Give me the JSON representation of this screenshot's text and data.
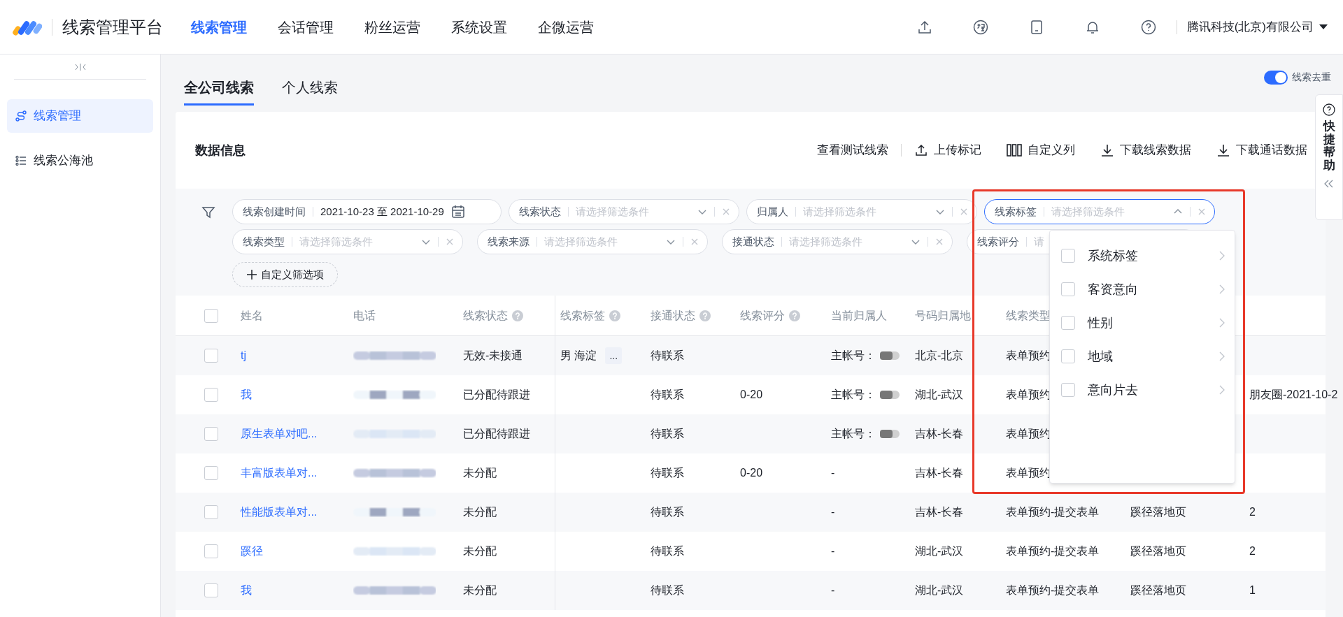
{
  "app": {
    "title": "线索管理平台"
  },
  "nav": [
    {
      "label": "线索管理",
      "selected": true
    },
    {
      "label": "会话管理",
      "selected": false
    },
    {
      "label": "粉丝运营",
      "selected": false
    },
    {
      "label": "系统设置",
      "selected": false
    },
    {
      "label": "企微运营",
      "selected": false
    }
  ],
  "account": {
    "company": "腾讯科技(北京)有限公司"
  },
  "sidebar": {
    "items": [
      {
        "label": "线索管理",
        "selected": true,
        "kind": "route"
      },
      {
        "label": "线索公海池",
        "selected": false,
        "kind": "pool"
      }
    ]
  },
  "tabs": [
    {
      "label": "全公司线索",
      "selected": true
    },
    {
      "label": "个人线索",
      "selected": false
    }
  ],
  "dedupe_toggle": {
    "label": "线索去重",
    "on": true
  },
  "section_title": "数据信息",
  "actions": [
    {
      "label": "查看测试线索",
      "kind": "text"
    },
    {
      "label": "上传标记",
      "kind": "upload"
    },
    {
      "label": "自定义列",
      "kind": "columns"
    },
    {
      "label": "下载线索数据",
      "kind": "download"
    },
    {
      "label": "下载通话数据",
      "kind": "download"
    }
  ],
  "filter_rows": [
    [
      {
        "label": "线索创建时间",
        "kind": "date",
        "value": "2021-10-23 至 2021-10-29"
      },
      {
        "label": "线索状态",
        "kind": "select",
        "placeholder": "请选择筛选条件",
        "open": false
      },
      {
        "label": "归属人",
        "kind": "select",
        "placeholder": "请选择筛选条件",
        "open": false
      },
      {
        "label": "线索标签",
        "kind": "select",
        "placeholder": "请选择筛选条件",
        "open": true
      }
    ],
    [
      {
        "label": "线索类型",
        "kind": "select",
        "placeholder": "请选择筛选条件",
        "open": false
      },
      {
        "label": "线索来源",
        "kind": "select",
        "placeholder": "请选择筛选条件",
        "open": false
      },
      {
        "label": "接通状态",
        "kind": "select",
        "placeholder": "请选择筛选条件",
        "open": false
      },
      {
        "label": "线索评分",
        "kind": "partial",
        "placeholder": "请",
        "open": false
      }
    ]
  ],
  "custom_filter_button": "自定义筛选项",
  "dropdown": {
    "items": [
      {
        "label": "系统标签",
        "checked": false
      },
      {
        "label": "客资意向",
        "checked": false
      },
      {
        "label": "性别",
        "checked": false
      },
      {
        "label": "地域",
        "checked": false
      },
      {
        "label": "意向片去",
        "checked": false
      }
    ]
  },
  "table": {
    "select_all": {
      "checked": false
    },
    "columns": [
      {
        "label": "姓名",
        "help": false
      },
      {
        "label": "电话",
        "help": false
      },
      {
        "label": "线索状态",
        "help": true
      },
      {
        "label": "线索标签",
        "help": true
      },
      {
        "label": "接通状态",
        "help": true
      },
      {
        "label": "线索评分",
        "help": true
      },
      {
        "label": "当前归属人",
        "help": false
      },
      {
        "label": "号码归属地",
        "help": false
      },
      {
        "label": "线索类型",
        "help": false
      }
    ],
    "rows": [
      {
        "checked": false,
        "name": "tj",
        "status": "无效-未接通",
        "tags": "男 海淀",
        "more": "...",
        "connect": "待联系",
        "owner": "主帐号：",
        "owner_masked": true,
        "location": "北京-北京",
        "type": "表单预约"
      },
      {
        "checked": false,
        "name": "我",
        "status": "已分配待跟进",
        "connect": "待联系",
        "score": "0-20",
        "owner": "主帐号：",
        "owner_masked": true,
        "location": "湖北-武汉",
        "type": "表单预约",
        "column_12": "朋友圈-2021-10-2"
      },
      {
        "checked": false,
        "name": "原生表单对吧...",
        "status": "已分配待跟进",
        "connect": "待联系",
        "owner": "主帐号：",
        "owner_masked": true,
        "location": "吉林-长春",
        "type": "表单预约"
      },
      {
        "checked": false,
        "name": "丰富版表单对...",
        "status": "未分配",
        "connect": "待联系",
        "score": "0-20",
        "owner": "-",
        "owner_masked": false,
        "location": "吉林-长春",
        "type": "表单预约"
      },
      {
        "checked": false,
        "name": "性能版表单对...",
        "status": "未分配",
        "connect": "待联系",
        "owner": "-",
        "owner_masked": false,
        "location": "吉林-长春",
        "type": "表单预约-提交表单",
        "source": "蹊径落地页",
        "column_12": "2"
      },
      {
        "checked": false,
        "name": "蹊径",
        "status": "未分配",
        "connect": "待联系",
        "owner": "-",
        "owner_masked": false,
        "location": "湖北-武汉",
        "type": "表单预约-提交表单",
        "source": "蹊径落地页",
        "column_12": "2"
      },
      {
        "checked": false,
        "name": "我",
        "status": "未分配",
        "connect": "待联系",
        "owner": "-",
        "owner_masked": false,
        "location": "湖北-武汉",
        "type": "表单预约-提交表单",
        "source": "蹊径落地页",
        "column_12": "1"
      }
    ]
  },
  "help_panel": {
    "label": "快捷帮助"
  }
}
